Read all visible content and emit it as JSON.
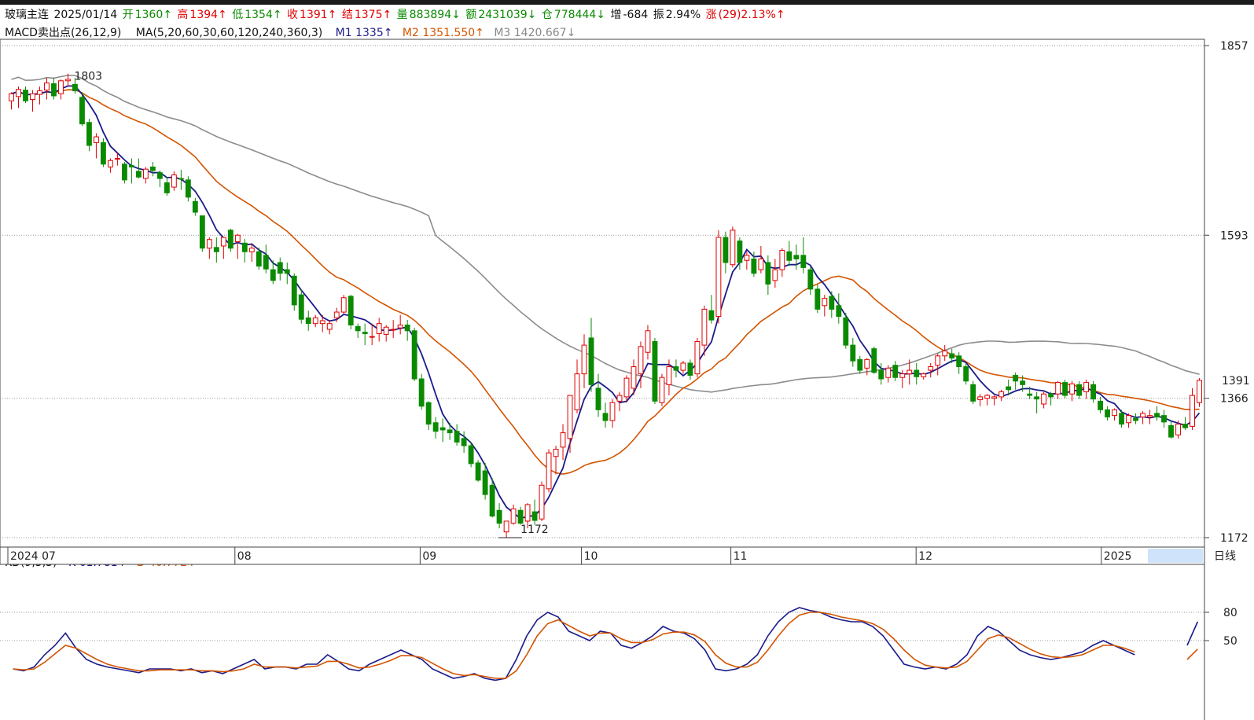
{
  "header": {
    "symbol": "玻璃主连",
    "date": "2025/01/14",
    "open_label": "开",
    "open": "1360↑",
    "high_label": "高",
    "high": "1394↑",
    "low_label": "低",
    "low": "1354↑",
    "close_label": "收",
    "close": "1391↑",
    "settle_label": "结",
    "settle": "1375↑",
    "volume_label": "量",
    "volume": "883894↓",
    "amount_label": "额",
    "amount": "2431039↓",
    "oi_label": "仓",
    "oi": "778444↓",
    "oi_change_label": "增",
    "oi_change": "-684",
    "amplitude_label": "振",
    "amplitude": "2.94%",
    "change_label": "涨",
    "change": "(29)2.13%↑"
  },
  "indicator_line": {
    "macd": "MACD卖出点(26,12,9)",
    "ma": "MA(5,20,60,30,60,120,240,360,3)",
    "m1": "M1 1335↑",
    "m2": "M2 1351.550↑",
    "m3": "M3 1420.667↓"
  },
  "kd_line": {
    "kd": "KD(9,3,3)",
    "k": "K 61.781↑",
    "d": "D 40.772↑"
  },
  "colors": {
    "up": "#e00000",
    "down": "#0a8a00",
    "m1": "#1a1a8a",
    "m2": "#d35400",
    "m3": "#8c8c8c",
    "k": "#1a1a8a",
    "d": "#d35400"
  },
  "chart_data": [
    {
      "type": "candlestick",
      "y_ticks": [
        "1857",
        "1593",
        "1366",
        "1172"
      ],
      "ylim": [
        1172,
        1857
      ],
      "current_price_label": "1391",
      "max_label": "1803",
      "min_label": "1172",
      "x_ticks": [
        "2024 07",
        "08",
        "09",
        "10",
        "11",
        "12",
        "2025"
      ],
      "period": "日线",
      "ohlc": [
        [
          1780,
          1792,
          1768,
          1790
        ],
        [
          1786,
          1800,
          1770,
          1796
        ],
        [
          1795,
          1800,
          1777,
          1780
        ],
        [
          1782,
          1795,
          1765,
          1790
        ],
        [
          1789,
          1800,
          1775,
          1794
        ],
        [
          1795,
          1812,
          1782,
          1805
        ],
        [
          1804,
          1812,
          1782,
          1787
        ],
        [
          1790,
          1810,
          1782,
          1808
        ],
        [
          1808,
          1818,
          1800,
          1810
        ],
        [
          1803,
          1812,
          1790,
          1794
        ],
        [
          1785,
          1792,
          1745,
          1748
        ],
        [
          1750,
          1755,
          1710,
          1718
        ],
        [
          1722,
          1735,
          1700,
          1730
        ],
        [
          1722,
          1728,
          1688,
          1692
        ],
        [
          1688,
          1700,
          1680,
          1697
        ],
        [
          1700,
          1708,
          1690,
          1700
        ],
        [
          1692,
          1695,
          1665,
          1670
        ],
        [
          1690,
          1700,
          1665,
          1688
        ],
        [
          1682,
          1700,
          1672,
          1674
        ],
        [
          1672,
          1688,
          1665,
          1685
        ],
        [
          1688,
          1695,
          1675,
          1683
        ],
        [
          1680,
          1683,
          1660,
          1672
        ],
        [
          1666,
          1674,
          1648,
          1652
        ],
        [
          1660,
          1682,
          1655,
          1677
        ],
        [
          1672,
          1684,
          1656,
          1671
        ],
        [
          1670,
          1675,
          1640,
          1646
        ],
        [
          1640,
          1645,
          1620,
          1625
        ],
        [
          1620,
          1620,
          1570,
          1575
        ],
        [
          1575,
          1590,
          1560,
          1587
        ],
        [
          1576,
          1590,
          1555,
          1570
        ],
        [
          1578,
          1590,
          1560,
          1590
        ],
        [
          1600,
          1602,
          1570,
          1575
        ],
        [
          1584,
          1595,
          1560,
          1593
        ],
        [
          1582,
          1588,
          1555,
          1570
        ],
        [
          1570,
          1582,
          1556,
          1575
        ],
        [
          1570,
          1576,
          1545,
          1550
        ],
        [
          1565,
          1580,
          1540,
          1546
        ],
        [
          1545,
          1558,
          1525,
          1530
        ],
        [
          1555,
          1562,
          1530,
          1540
        ],
        [
          1545,
          1555,
          1525,
          1540
        ],
        [
          1536,
          1540,
          1488,
          1496
        ],
        [
          1510,
          1518,
          1470,
          1476
        ],
        [
          1478,
          1488,
          1460,
          1470
        ],
        [
          1470,
          1482,
          1465,
          1478
        ],
        [
          1470,
          1482,
          1458,
          1474
        ],
        [
          1462,
          1475,
          1455,
          1470
        ],
        [
          1478,
          1492,
          1472,
          1486
        ],
        [
          1486,
          1510,
          1484,
          1506
        ],
        [
          1508,
          1510,
          1462,
          1468
        ],
        [
          1466,
          1470,
          1450,
          1460
        ],
        [
          1458,
          1470,
          1440,
          1456
        ],
        [
          1452,
          1470,
          1440,
          1452
        ],
        [
          1456,
          1478,
          1445,
          1470
        ],
        [
          1455,
          1468,
          1445,
          1465
        ],
        [
          1462,
          1475,
          1450,
          1462
        ],
        [
          1464,
          1482,
          1455,
          1468
        ],
        [
          1468,
          1475,
          1446,
          1460
        ],
        [
          1460,
          1464,
          1390,
          1393
        ],
        [
          1393,
          1400,
          1350,
          1355
        ],
        [
          1360,
          1362,
          1322,
          1330
        ],
        [
          1332,
          1340,
          1310,
          1320
        ],
        [
          1325,
          1338,
          1305,
          1322
        ],
        [
          1322,
          1332,
          1308,
          1318
        ],
        [
          1320,
          1330,
          1300,
          1305
        ],
        [
          1310,
          1320,
          1290,
          1300
        ],
        [
          1300,
          1305,
          1270,
          1275
        ],
        [
          1276,
          1280,
          1250,
          1252
        ],
        [
          1265,
          1276,
          1225,
          1232
        ],
        [
          1245,
          1255,
          1200,
          1202
        ],
        [
          1210,
          1220,
          1185,
          1192
        ],
        [
          1180,
          1195,
          1172,
          1195
        ],
        [
          1192,
          1218,
          1190,
          1212
        ],
        [
          1210,
          1215,
          1190,
          1192
        ],
        [
          1195,
          1220,
          1185,
          1218
        ],
        [
          1208,
          1225,
          1190,
          1196
        ],
        [
          1198,
          1250,
          1195,
          1245
        ],
        [
          1240,
          1295,
          1235,
          1290
        ],
        [
          1285,
          1300,
          1260,
          1295
        ],
        [
          1298,
          1330,
          1280,
          1318
        ],
        [
          1310,
          1340,
          1290,
          1370
        ],
        [
          1350,
          1420,
          1345,
          1400
        ],
        [
          1400,
          1455,
          1380,
          1440
        ],
        [
          1450,
          1478,
          1375,
          1385
        ],
        [
          1380,
          1400,
          1340,
          1350
        ],
        [
          1345,
          1360,
          1325,
          1335
        ],
        [
          1335,
          1365,
          1325,
          1360
        ],
        [
          1362,
          1375,
          1348,
          1370
        ],
        [
          1368,
          1398,
          1360,
          1394
        ],
        [
          1380,
          1420,
          1370,
          1410
        ],
        [
          1400,
          1445,
          1380,
          1438
        ],
        [
          1430,
          1468,
          1420,
          1460
        ],
        [
          1445,
          1450,
          1358,
          1362
        ],
        [
          1360,
          1400,
          1355,
          1395
        ],
        [
          1385,
          1420,
          1370,
          1410
        ],
        [
          1410,
          1420,
          1395,
          1405
        ],
        [
          1405,
          1418,
          1400,
          1415
        ],
        [
          1415,
          1420,
          1392,
          1398
        ],
        [
          1400,
          1450,
          1395,
          1445
        ],
        [
          1440,
          1495,
          1425,
          1490
        ],
        [
          1488,
          1510,
          1470,
          1475
        ],
        [
          1480,
          1600,
          1470,
          1590
        ],
        [
          1590,
          1598,
          1540,
          1555
        ],
        [
          1552,
          1605,
          1548,
          1600
        ],
        [
          1585,
          1590,
          1545,
          1555
        ],
        [
          1558,
          1570,
          1545,
          1565
        ],
        [
          1560,
          1570,
          1535,
          1540
        ],
        [
          1545,
          1578,
          1540,
          1560
        ],
        [
          1555,
          1565,
          1510,
          1525
        ],
        [
          1530,
          1560,
          1520,
          1545
        ],
        [
          1545,
          1575,
          1535,
          1572
        ],
        [
          1570,
          1585,
          1550,
          1558
        ],
        [
          1565,
          1580,
          1545,
          1560
        ],
        [
          1565,
          1590,
          1540,
          1548
        ],
        [
          1545,
          1550,
          1510,
          1518
        ],
        [
          1518,
          1525,
          1485,
          1490
        ],
        [
          1495,
          1510,
          1480,
          1505
        ],
        [
          1508,
          1515,
          1478,
          1490
        ],
        [
          1495,
          1512,
          1470,
          1480
        ],
        [
          1478,
          1485,
          1435,
          1440
        ],
        [
          1440,
          1450,
          1410,
          1418
        ],
        [
          1420,
          1425,
          1400,
          1405
        ],
        [
          1408,
          1422,
          1398,
          1420
        ],
        [
          1435,
          1438,
          1400,
          1402
        ],
        [
          1405,
          1415,
          1385,
          1393
        ],
        [
          1395,
          1412,
          1388,
          1408
        ],
        [
          1412,
          1418,
          1390,
          1395
        ],
        [
          1395,
          1405,
          1380,
          1400
        ],
        [
          1400,
          1420,
          1385,
          1405
        ],
        [
          1405,
          1415,
          1385,
          1396
        ],
        [
          1396,
          1402,
          1392,
          1400
        ],
        [
          1405,
          1415,
          1395,
          1410
        ],
        [
          1412,
          1428,
          1398,
          1425
        ],
        [
          1425,
          1440,
          1418,
          1432
        ],
        [
          1428,
          1435,
          1415,
          1422
        ],
        [
          1425,
          1430,
          1400,
          1410
        ],
        [
          1410,
          1415,
          1385,
          1390
        ],
        [
          1385,
          1390,
          1358,
          1362
        ],
        [
          1364,
          1372,
          1355,
          1368
        ],
        [
          1366,
          1372,
          1356,
          1370
        ],
        [
          1366,
          1370,
          1356,
          1368
        ],
        [
          1368,
          1378,
          1362,
          1375
        ],
        [
          1382,
          1392,
          1370,
          1378
        ],
        [
          1398,
          1402,
          1378,
          1390
        ],
        [
          1390,
          1398,
          1375,
          1385
        ],
        [
          1372,
          1382,
          1365,
          1370
        ],
        [
          1368,
          1375,
          1345,
          1365
        ],
        [
          1358,
          1375,
          1352,
          1372
        ],
        [
          1372,
          1375,
          1356,
          1368
        ],
        [
          1372,
          1390,
          1365,
          1388
        ],
        [
          1388,
          1392,
          1366,
          1370
        ],
        [
          1372,
          1390,
          1362,
          1386
        ],
        [
          1385,
          1390,
          1365,
          1370
        ],
        [
          1375,
          1392,
          1365,
          1388
        ],
        [
          1385,
          1390,
          1360,
          1365
        ],
        [
          1362,
          1368,
          1345,
          1350
        ],
        [
          1350,
          1355,
          1335,
          1340
        ],
        [
          1342,
          1352,
          1335,
          1350
        ],
        [
          1345,
          1350,
          1325,
          1330
        ],
        [
          1332,
          1345,
          1325,
          1342
        ],
        [
          1338,
          1345,
          1330,
          1335
        ],
        [
          1340,
          1348,
          1330,
          1345
        ],
        [
          1340,
          1350,
          1330,
          1342
        ],
        [
          1345,
          1355,
          1335,
          1340
        ],
        [
          1342,
          1350,
          1325,
          1333
        ],
        [
          1328,
          1335,
          1310,
          1312
        ],
        [
          1315,
          1335,
          1310,
          1330
        ],
        [
          1330,
          1340,
          1322,
          1325
        ],
        [
          1327,
          1380,
          1322,
          1370
        ],
        [
          1360,
          1394,
          1354,
          1391
        ]
      ],
      "m1_label": "M1",
      "m2_label": "M2",
      "m3_label": "M3"
    },
    {
      "type": "line",
      "title": "KD(9,3,3)",
      "y_ticks": [
        "80",
        "50"
      ],
      "series": [
        {
          "name": "K",
          "values": [
            20,
            18,
            22,
            35,
            45,
            58,
            42,
            30,
            25,
            22,
            20,
            18,
            16,
            20,
            20,
            20,
            18,
            20,
            16,
            18,
            15,
            20,
            25,
            30,
            20,
            22,
            22,
            20,
            25,
            25,
            35,
            28,
            20,
            18,
            25,
            30,
            35,
            40,
            35,
            30,
            20,
            15,
            10,
            12,
            15,
            10,
            8,
            10,
            30,
            55,
            72,
            80,
            75,
            60,
            55,
            50,
            60,
            58,
            45,
            42,
            48,
            55,
            65,
            60,
            58,
            52,
            40,
            20,
            18,
            20,
            25,
            35,
            55,
            70,
            80,
            85,
            82,
            80,
            75,
            72,
            70,
            70,
            65,
            55,
            40,
            25,
            22,
            20,
            22,
            20,
            25,
            35,
            55,
            65,
            60,
            50,
            40,
            35,
            32,
            30,
            32,
            35,
            38,
            45,
            50,
            45,
            40,
            35,
            0,
            0,
            0,
            0,
            45,
            70
          ]
        },
        {
          "name": "D",
          "values": [
            20,
            19,
            20,
            27,
            36,
            45,
            42,
            36,
            30,
            25,
            22,
            20,
            18,
            18,
            19,
            19,
            19,
            19,
            18,
            18,
            17,
            18,
            20,
            25,
            22,
            22,
            22,
            21,
            22,
            23,
            28,
            28,
            25,
            21,
            22,
            25,
            29,
            34,
            34,
            32,
            26,
            20,
            15,
            13,
            14,
            12,
            10,
            10,
            18,
            35,
            55,
            68,
            72,
            66,
            60,
            55,
            58,
            58,
            52,
            48,
            48,
            51,
            57,
            59,
            59,
            56,
            49,
            35,
            26,
            22,
            22,
            27,
            40,
            55,
            68,
            77,
            80,
            80,
            78,
            75,
            73,
            71,
            68,
            62,
            52,
            40,
            30,
            24,
            22,
            21,
            22,
            28,
            40,
            52,
            56,
            53,
            47,
            41,
            36,
            33,
            32,
            33,
            35,
            40,
            45,
            45,
            42,
            38,
            0,
            0,
            0,
            0,
            30,
            41
          ]
        }
      ]
    }
  ]
}
